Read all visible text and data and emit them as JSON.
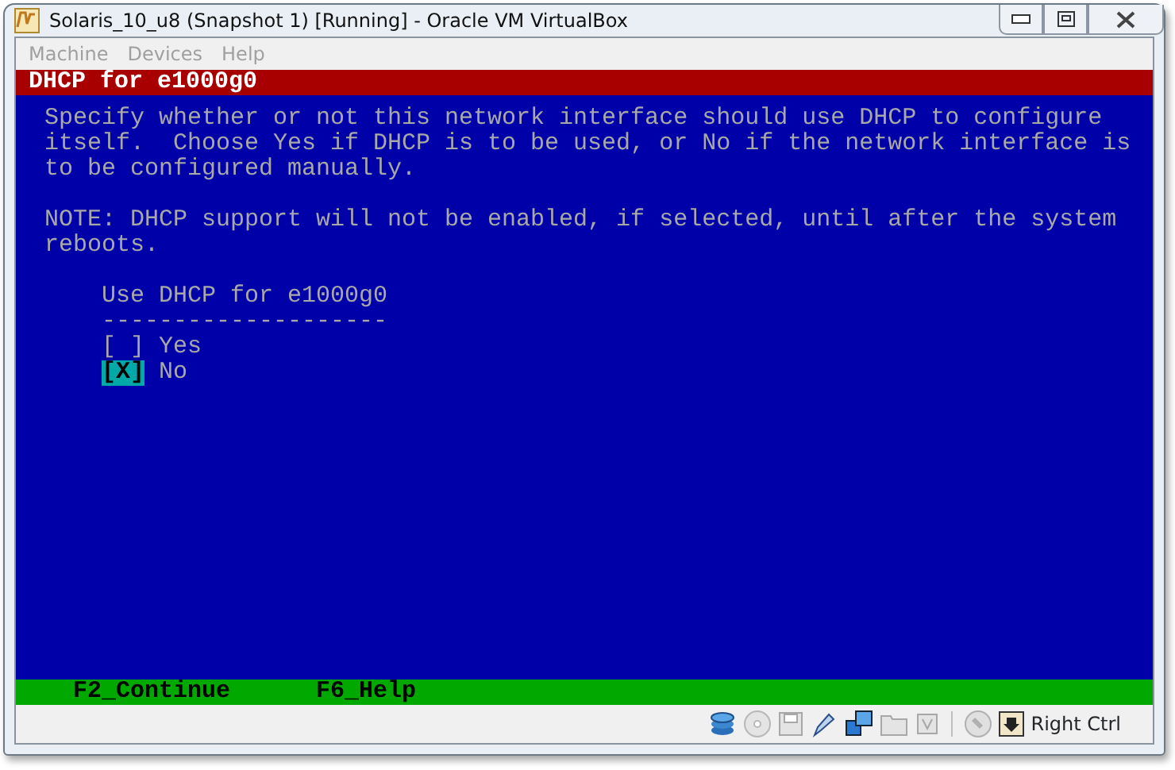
{
  "window": {
    "title": "Solaris_10_u8 (Snapshot 1) [Running] - Oracle VM VirtualBox"
  },
  "menu": [
    "Machine",
    "Devices",
    "Help"
  ],
  "console": {
    "header": "DHCP for e1000g0",
    "paragraphs": [
      "Specify whether or not this network interface should use DHCP to configure\nitself.  Choose Yes if DHCP is to be used, or No if the network interface is\nto be configured manually.",
      "NOTE: DHCP support will not be enabled, if selected, until after the system\nreboots."
    ],
    "question": "Use DHCP for e1000g0",
    "rule": "--------------------",
    "options": [
      {
        "box": "[ ]",
        "label": "Yes",
        "selected": false
      },
      {
        "box": "[X]",
        "label": "No",
        "selected": true
      }
    ],
    "footer": [
      "F2_Continue",
      "F6_Help"
    ]
  },
  "status_bar": {
    "host_key": "Right Ctrl"
  }
}
